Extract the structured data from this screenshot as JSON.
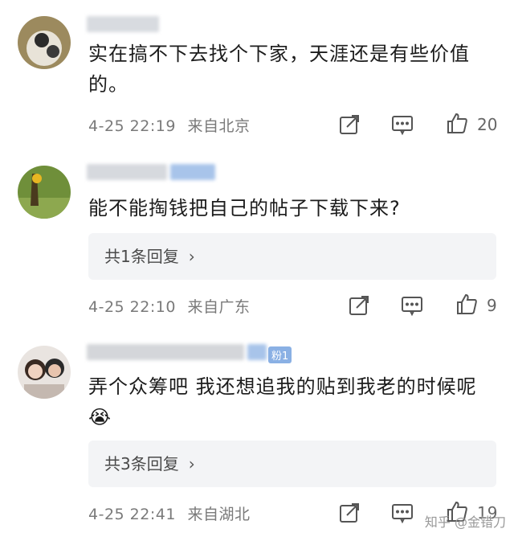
{
  "comments": [
    {
      "text": "实在搞不下去找个下家，天涯还是有些价值的。",
      "time": "4-25 22:19",
      "location": "来自北京",
      "likes": "20"
    },
    {
      "text": "能不能掏钱把自己的帖子下载下来?",
      "time": "4-25 22:10",
      "location": "来自广东",
      "likes": "9",
      "replies": "共1条回复"
    },
    {
      "text": "弄个众筹吧 我还想追我的贴到我老的时候呢😭",
      "time": "4-25 22:41",
      "location": "来自湖北",
      "likes": "19",
      "replies": "共3条回复",
      "fan_badge": "粉1"
    }
  ],
  "icons": {
    "share": "share-icon",
    "comment": "comment-icon",
    "like": "thumbs-up-icon"
  },
  "watermark": "知乎 @金错刀"
}
